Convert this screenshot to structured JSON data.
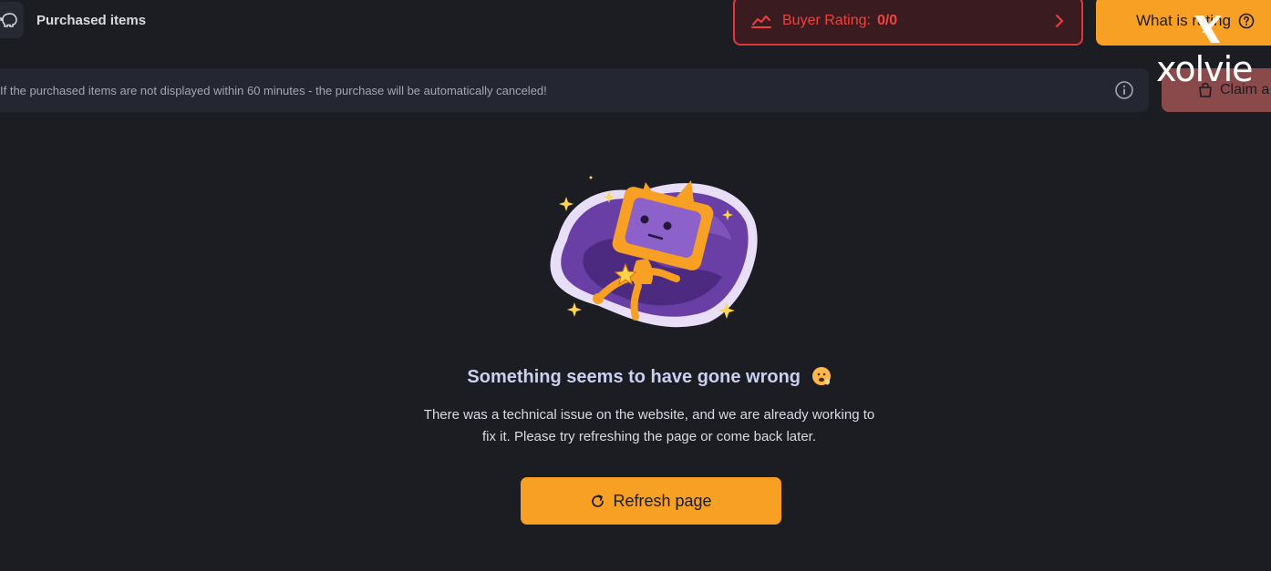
{
  "header": {
    "title": "Purchased items",
    "icon": "piggy-bank-icon"
  },
  "rating_button": {
    "label": "Buyer Rating:",
    "value": "0/0",
    "icon": "trend-chart-icon",
    "accent": "#e0383a"
  },
  "what_button": {
    "label": "What is rating",
    "icon": "help-circle-icon",
    "color": "#f8a024"
  },
  "notice": {
    "text": "If the purchased items are not displayed within 60 minutes - the purchase will be automatically canceled!",
    "icon": "info-icon"
  },
  "claim_button": {
    "label": "Claim a",
    "icon": "shopping-bag-icon"
  },
  "watermark": {
    "text": "xolvie"
  },
  "error": {
    "title": "Something seems to have gone wrong",
    "description": "There was a technical issue on the website, and we are already working to fix it. Please try refreshing the page or come back later.",
    "emoji": "worried-face-emoji"
  },
  "refresh_button": {
    "label": "Refresh page",
    "icon": "refresh-icon",
    "color": "#f8a024"
  }
}
